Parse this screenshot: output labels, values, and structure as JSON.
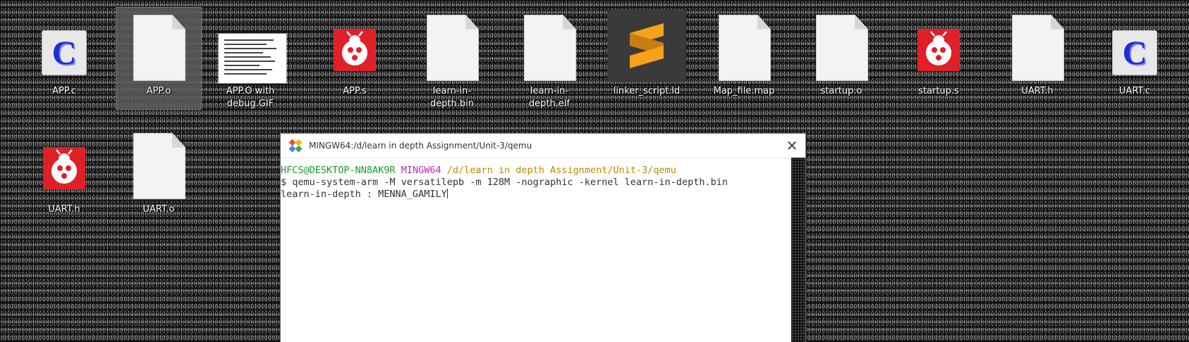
{
  "desktop": {
    "icons": [
      {
        "label": "APP.c",
        "type": "c-source"
      },
      {
        "label": "APP.o",
        "type": "file",
        "selected": true
      },
      {
        "label": "APP.O with debug.GIF",
        "type": "gif"
      },
      {
        "label": "APP.s",
        "type": "ladybug"
      },
      {
        "label": "learn-in-depth.bin",
        "type": "file"
      },
      {
        "label": "learn-in-depth.elf",
        "type": "file"
      },
      {
        "label": "linker_script.ld",
        "type": "sublime"
      },
      {
        "label": "Map_file.map",
        "type": "file"
      },
      {
        "label": "startup.o",
        "type": "file"
      },
      {
        "label": "startup.s",
        "type": "ladybug"
      },
      {
        "label": "UART.h",
        "type": "file"
      },
      {
        "label": "UART.c",
        "type": "c-source"
      },
      {
        "label": "UART.h",
        "type": "ladybug"
      },
      {
        "label": "UART.o",
        "type": "file"
      }
    ]
  },
  "terminal": {
    "title": "MINGW64:/d/learn in depth Assignment/Unit-3/qemu",
    "prompt_user": "HFCS@DESKTOP-NN8AK9R",
    "prompt_shell": "MINGW64",
    "prompt_path": "/d/learn in depth Assignment/Unit-3/qemu",
    "command": "$ qemu-system-arm -M versatilepb -m 128M -nographic -kernel learn-in-depth.bin",
    "output": "learn-in-depth : MENNA_GAMILY",
    "close_symbol": "✕"
  },
  "colors": {
    "prompt_user": "#1a9a2a",
    "prompt_shell": "#b430b4",
    "prompt_path": "#b88a00",
    "ladybug": "#e02028",
    "sublime_orange": "#f7a21b",
    "c_blue": "#1f2fd6"
  }
}
